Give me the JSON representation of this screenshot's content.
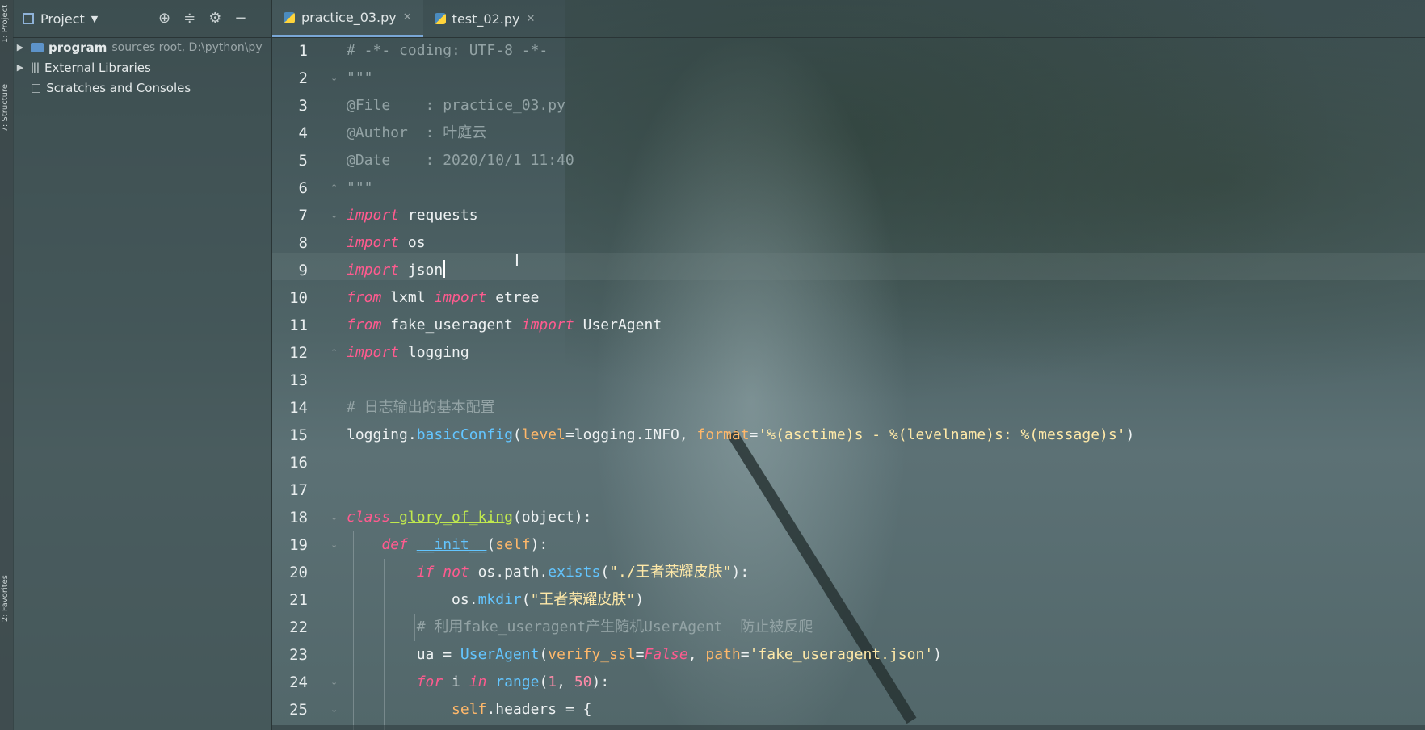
{
  "sidebar_strip": {
    "project_label": "1: Project",
    "structure_label": "7: Structure",
    "favorites_label": "2: Favorites"
  },
  "project_panel": {
    "title": "Project",
    "toolbar_icons": [
      "crosshair-icon",
      "collapse-icon",
      "gear-icon",
      "minimize-icon"
    ],
    "tree": [
      {
        "name": "program",
        "hint": "sources root, D:\\python\\py"
      },
      {
        "name": "External Libraries",
        "hint": ""
      },
      {
        "name": "Scratches and Consoles",
        "hint": ""
      }
    ]
  },
  "tabs": [
    {
      "label": "practice_03.py",
      "active": true
    },
    {
      "label": "test_02.py",
      "active": false
    }
  ],
  "colors": {
    "keyword": "#ff5b8f",
    "function": "#63c5ff",
    "string": "#ffe9a8",
    "comment": "#93a3a5",
    "accent": "#7aa7d6"
  },
  "editor": {
    "current_line": 9,
    "lines": [
      {
        "n": "1",
        "t": "# -*- coding: UTF-8 -*-"
      },
      {
        "n": "2",
        "t": "\"\"\""
      },
      {
        "n": "3",
        "t": "@File    : practice_03.py"
      },
      {
        "n": "4",
        "t": "@Author  : 叶庭云"
      },
      {
        "n": "5",
        "t": "@Date    : 2020/10/1 11:40"
      },
      {
        "n": "6",
        "t": "\"\"\""
      },
      {
        "n": "7",
        "t": "import requests"
      },
      {
        "n": "8",
        "t": "import os"
      },
      {
        "n": "9",
        "t": "import json"
      },
      {
        "n": "10",
        "t": "from lxml import etree"
      },
      {
        "n": "11",
        "t": "from fake_useragent import UserAgent"
      },
      {
        "n": "12",
        "t": "import logging"
      },
      {
        "n": "13",
        "t": ""
      },
      {
        "n": "14",
        "t": "# 日志输出的基本配置"
      },
      {
        "n": "15",
        "t": "logging.basicConfig(level=logging.INFO, format='%(asctime)s - %(levelname)s: %(message)s')"
      },
      {
        "n": "16",
        "t": ""
      },
      {
        "n": "17",
        "t": ""
      },
      {
        "n": "18",
        "t": "class glory_of_king(object):"
      },
      {
        "n": "19",
        "t": "    def __init__(self):"
      },
      {
        "n": "20",
        "t": "        if not os.path.exists(\"./王者荣耀皮肤\"):"
      },
      {
        "n": "21",
        "t": "            os.mkdir(\"王者荣耀皮肤\")"
      },
      {
        "n": "22",
        "t": "        # 利用fake_useragent产生随机UserAgent  防止被反爬"
      },
      {
        "n": "23",
        "t": "        ua = UserAgent(verify_ssl=False, path='fake_useragent.json')"
      },
      {
        "n": "24",
        "t": "        for i in range(1, 50):"
      },
      {
        "n": "25",
        "t": "            self.headers = {"
      }
    ]
  }
}
